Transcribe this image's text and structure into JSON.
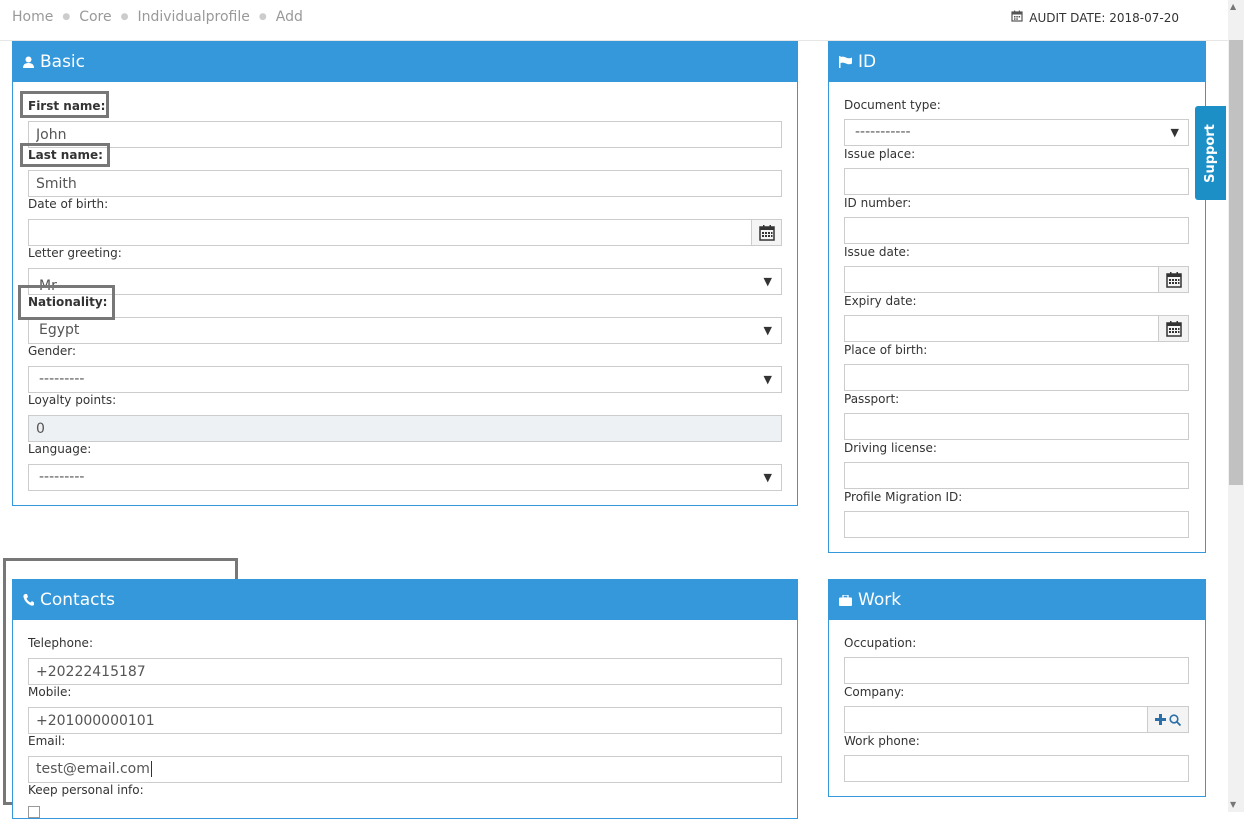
{
  "breadcrumb": [
    "Home",
    "Core",
    "Individualprofile",
    "Add"
  ],
  "audit": {
    "label": "AUDIT DATE: 2018-07-20"
  },
  "support": {
    "label": "Support"
  },
  "basic": {
    "title": "Basic",
    "first_name_label": "First name:",
    "first_name_value": "John",
    "last_name_label": "Last name:",
    "last_name_value": "Smith",
    "dob_label": "Date of birth:",
    "dob_value": "",
    "greeting_label": "Letter greeting:",
    "greeting_value": "Mr",
    "nationality_label": "Nationality:",
    "nationality_value": "Egypt",
    "gender_label": "Gender:",
    "gender_value": "---------",
    "loyalty_label": "Loyalty points:",
    "loyalty_value": "0",
    "language_label": "Language:",
    "language_value": "---------"
  },
  "id": {
    "title": "ID",
    "doc_type_label": "Document type:",
    "doc_type_value": "-----------",
    "issue_place_label": "Issue place:",
    "id_number_label": "ID number:",
    "issue_date_label": "Issue date:",
    "expiry_date_label": "Expiry date:",
    "place_of_birth_label": "Place of birth:",
    "passport_label": "Passport:",
    "driving_license_label": "Driving license:",
    "migration_id_label": "Profile Migration ID:"
  },
  "contacts": {
    "title": "Contacts",
    "telephone_label": "Telephone:",
    "telephone_value": "+20222415187",
    "mobile_label": "Mobile:",
    "mobile_value": "+201000000101",
    "email_label": "Email:",
    "email_value": "test@email.com",
    "keep_personal_label": "Keep personal info:"
  },
  "work": {
    "title": "Work",
    "occupation_label": "Occupation:",
    "company_label": "Company:",
    "work_phone_label": "Work phone:"
  },
  "icons": {
    "calendar": "calendar-icon",
    "user": "user-icon",
    "flag": "flag-icon",
    "phone": "phone-icon",
    "briefcase": "briefcase-icon",
    "plus": "plus-icon",
    "search": "search-icon"
  },
  "colors": {
    "accent": "#3498db",
    "support": "#1c8fc6",
    "highlight": "#777777"
  }
}
